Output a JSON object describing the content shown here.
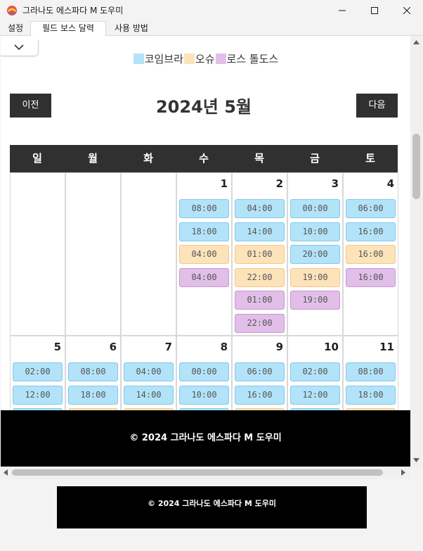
{
  "window": {
    "title": "그라나도 에스파다 M 도우미"
  },
  "tabs": [
    {
      "label": "설정",
      "active": false
    },
    {
      "label": "필드 보스 달력",
      "active": true
    },
    {
      "label": "사용 방법",
      "active": false
    }
  ],
  "legend": [
    {
      "label": "코임브라",
      "color": "#b3e3f9"
    },
    {
      "label": "오슈",
      "color": "#fde3ba"
    },
    {
      "label": "로스 톨도스",
      "color": "#e1bfe8"
    }
  ],
  "nav": {
    "prev": "이전",
    "next": "다음"
  },
  "month_title": "2024년 5월",
  "weekdays": [
    "일",
    "월",
    "화",
    "수",
    "목",
    "금",
    "토"
  ],
  "weeks": [
    [
      null,
      null,
      null,
      {
        "day": "1",
        "slots": [
          {
            "time": "08:00",
            "boss": "cobra"
          },
          {
            "time": "18:00",
            "boss": "cobra"
          },
          {
            "time": "04:00",
            "boss": "osyu"
          },
          {
            "time": "04:00",
            "boss": "roth"
          }
        ]
      },
      {
        "day": "2",
        "slots": [
          {
            "time": "04:00",
            "boss": "cobra"
          },
          {
            "time": "14:00",
            "boss": "cobra"
          },
          {
            "time": "01:00",
            "boss": "osyu"
          },
          {
            "time": "22:00",
            "boss": "osyu"
          },
          {
            "time": "01:00",
            "boss": "roth"
          },
          {
            "time": "22:00",
            "boss": "roth"
          }
        ]
      },
      {
        "day": "3",
        "slots": [
          {
            "time": "00:00",
            "boss": "cobra"
          },
          {
            "time": "10:00",
            "boss": "cobra"
          },
          {
            "time": "20:00",
            "boss": "cobra"
          },
          {
            "time": "19:00",
            "boss": "osyu"
          },
          {
            "time": "19:00",
            "boss": "roth"
          }
        ]
      },
      {
        "day": "4",
        "slots": [
          {
            "time": "06:00",
            "boss": "cobra"
          },
          {
            "time": "16:00",
            "boss": "cobra"
          },
          {
            "time": "16:00",
            "boss": "osyu"
          },
          {
            "time": "16:00",
            "boss": "roth"
          }
        ]
      }
    ],
    [
      {
        "day": "5",
        "slots": [
          {
            "time": "02:00",
            "boss": "cobra"
          },
          {
            "time": "12:00",
            "boss": "cobra"
          },
          {
            "time": "",
            "boss": "cobra"
          }
        ]
      },
      {
        "day": "6",
        "slots": [
          {
            "time": "08:00",
            "boss": "cobra"
          },
          {
            "time": "18:00",
            "boss": "cobra"
          },
          {
            "time": "",
            "boss": "osyu"
          }
        ]
      },
      {
        "day": "7",
        "slots": [
          {
            "time": "04:00",
            "boss": "cobra"
          },
          {
            "time": "14:00",
            "boss": "cobra"
          },
          {
            "time": "",
            "boss": "osyu"
          }
        ]
      },
      {
        "day": "8",
        "slots": [
          {
            "time": "00:00",
            "boss": "cobra"
          },
          {
            "time": "10:00",
            "boss": "cobra"
          },
          {
            "time": "",
            "boss": "cobra"
          }
        ]
      },
      {
        "day": "9",
        "slots": [
          {
            "time": "06:00",
            "boss": "cobra"
          },
          {
            "time": "16:00",
            "boss": "cobra"
          },
          {
            "time": "",
            "boss": "osyu"
          }
        ]
      },
      {
        "day": "10",
        "slots": [
          {
            "time": "02:00",
            "boss": "cobra"
          },
          {
            "time": "12:00",
            "boss": "cobra"
          },
          {
            "time": "",
            "boss": "cobra"
          }
        ]
      },
      {
        "day": "11",
        "slots": [
          {
            "time": "08:00",
            "boss": "cobra"
          },
          {
            "time": "18:00",
            "boss": "cobra"
          },
          {
            "time": "",
            "boss": "osyu"
          }
        ]
      }
    ]
  ],
  "footer": {
    "inner": "© 2024 그라나도 에스파다 M 도우미",
    "outer": "© 2024 그라나도 에스파다 M 도우미"
  }
}
